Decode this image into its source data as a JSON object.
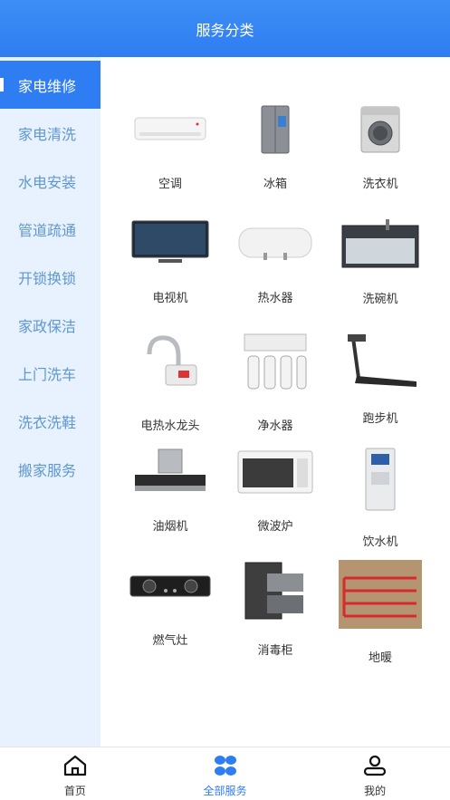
{
  "header": {
    "title": "服务分类"
  },
  "sidebar": {
    "items": [
      {
        "label": "家电维修"
      },
      {
        "label": "家电清洗"
      },
      {
        "label": "水电安装"
      },
      {
        "label": "管道疏通"
      },
      {
        "label": "开锁换锁"
      },
      {
        "label": "家政保洁"
      },
      {
        "label": "上门洗车"
      },
      {
        "label": "洗衣洗鞋"
      },
      {
        "label": "搬家服务"
      }
    ]
  },
  "grid": {
    "items": [
      {
        "label": "空调",
        "icon": "air-conditioner-icon"
      },
      {
        "label": "冰箱",
        "icon": "refrigerator-icon"
      },
      {
        "label": "洗衣机",
        "icon": "washing-machine-icon"
      },
      {
        "label": "电视机",
        "icon": "tv-icon"
      },
      {
        "label": "热水器",
        "icon": "water-heater-icon"
      },
      {
        "label": "洗碗机",
        "icon": "dishwasher-icon"
      },
      {
        "label": "电热水龙头",
        "icon": "electric-faucet-icon"
      },
      {
        "label": "净水器",
        "icon": "water-purifier-icon"
      },
      {
        "label": "跑步机",
        "icon": "treadmill-icon"
      },
      {
        "label": "油烟机",
        "icon": "range-hood-icon"
      },
      {
        "label": "微波炉",
        "icon": "microwave-icon"
      },
      {
        "label": "饮水机",
        "icon": "water-dispenser-icon"
      },
      {
        "label": "燃气灶",
        "icon": "gas-stove-icon"
      },
      {
        "label": "消毒柜",
        "icon": "sterilizer-cabinet-icon"
      },
      {
        "label": "地暖",
        "icon": "floor-heating-icon"
      }
    ]
  },
  "tabbar": {
    "items": [
      {
        "label": "首页",
        "icon": "home-icon"
      },
      {
        "label": "全部服务",
        "icon": "all-services-icon"
      },
      {
        "label": "我的",
        "icon": "profile-icon"
      }
    ],
    "active_color": "#2f7df2"
  },
  "colors": {
    "primary": "#2f7df2",
    "sidebar_bg": "#e8f2ff",
    "sidebar_text": "#5f97cf"
  }
}
